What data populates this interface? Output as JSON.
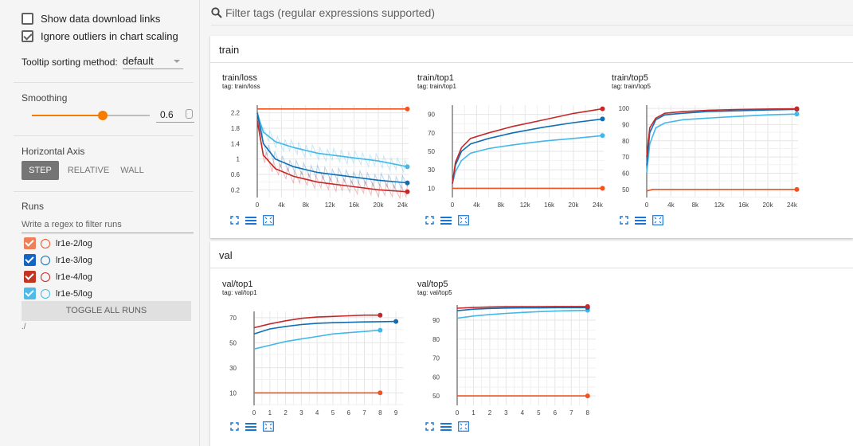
{
  "sidebar": {
    "show_download_label": "Show data download links",
    "ignore_outliers_label": "Ignore outliers in chart scaling",
    "tooltip_label": "Tooltip sorting method:",
    "tooltip_value": "default",
    "smoothing_label": "Smoothing",
    "smoothing_value": "0.6",
    "smoothing_fraction": 0.6,
    "horizontal_axis_label": "Horizontal Axis",
    "axis_options": [
      "STEP",
      "RELATIVE",
      "WALL"
    ],
    "runs_label": "Runs",
    "regex_placeholder": "Write a regex to filter runs",
    "runs": [
      {
        "name": "lr1e-2/log",
        "color": "#f4511e",
        "checkbox_color": "#ef7f57"
      },
      {
        "name": "lr1e-3/log",
        "color": "#0f6eb3",
        "checkbox_color": "#1565c0"
      },
      {
        "name": "lr1e-4/log",
        "color": "#c62828",
        "checkbox_color": "#c43421"
      },
      {
        "name": "lr1e-5/log",
        "color": "#42b8e8",
        "checkbox_color": "#4fb9e8"
      }
    ],
    "toggle_all_label": "TOGGLE ALL RUNS",
    "logdir": "./"
  },
  "filter": {
    "placeholder": "Filter tags (regular expressions supported)"
  },
  "groups": [
    {
      "title": "train"
    },
    {
      "title": "val"
    }
  ],
  "chart_data": [
    {
      "type": "line",
      "title": "train/loss",
      "tag": "tag: train/loss",
      "x_ticks": [
        "0",
        "4k",
        "8k",
        "12k",
        "16k",
        "20k",
        "24k"
      ],
      "y_ticks": [
        "2.2",
        "1.8",
        "1.4",
        "1",
        "0.6",
        "0.2"
      ],
      "xlim": [
        0,
        25000
      ],
      "ylim": [
        0,
        2.4
      ],
      "series": [
        {
          "run": "lr1e-2/log",
          "x": [
            0,
            5000,
            10000,
            15000,
            20000,
            24800
          ],
          "y": [
            2.3,
            2.3,
            2.3,
            2.3,
            2.3,
            2.3
          ]
        },
        {
          "run": "lr1e-5/log",
          "x": [
            0,
            1000,
            3000,
            6000,
            10000,
            15000,
            20000,
            24800
          ],
          "y": [
            2.2,
            1.7,
            1.45,
            1.3,
            1.15,
            1.05,
            0.95,
            0.8
          ]
        },
        {
          "run": "lr1e-3/log",
          "x": [
            0,
            1000,
            3000,
            6000,
            10000,
            15000,
            20000,
            24800
          ],
          "y": [
            2.2,
            1.4,
            1.0,
            0.8,
            0.65,
            0.55,
            0.45,
            0.38
          ]
        },
        {
          "run": "lr1e-4/log",
          "x": [
            0,
            1000,
            3000,
            6000,
            10000,
            15000,
            20000,
            24800
          ],
          "y": [
            2.0,
            1.1,
            0.75,
            0.55,
            0.4,
            0.3,
            0.2,
            0.15
          ]
        }
      ]
    },
    {
      "type": "line",
      "title": "train/top1",
      "tag": "tag: train/top1",
      "x_ticks": [
        "0",
        "4k",
        "8k",
        "12k",
        "16k",
        "20k",
        "24k"
      ],
      "y_ticks": [
        "90",
        "70",
        "50",
        "30",
        "10"
      ],
      "xlim": [
        0,
        25000
      ],
      "ylim": [
        0,
        100
      ],
      "series": [
        {
          "run": "lr1e-2/log",
          "x": [
            0,
            5000,
            10000,
            15000,
            20000,
            24800
          ],
          "y": [
            10,
            10,
            10,
            10,
            10,
            10
          ]
        },
        {
          "run": "lr1e-5/log",
          "x": [
            0,
            500,
            1500,
            3000,
            6000,
            10000,
            15000,
            20000,
            24800
          ],
          "y": [
            15,
            28,
            40,
            48,
            53,
            57,
            61,
            64,
            67
          ]
        },
        {
          "run": "lr1e-3/log",
          "x": [
            0,
            500,
            1500,
            3000,
            6000,
            10000,
            15000,
            20000,
            24800
          ],
          "y": [
            15,
            35,
            50,
            58,
            64,
            70,
            76,
            81,
            85
          ]
        },
        {
          "run": "lr1e-4/log",
          "x": [
            0,
            500,
            1500,
            3000,
            6000,
            10000,
            15000,
            20000,
            24800
          ],
          "y": [
            15,
            38,
            54,
            64,
            70,
            77,
            84,
            91,
            96
          ]
        }
      ]
    },
    {
      "type": "line",
      "title": "train/top5",
      "tag": "tag: train/top5",
      "x_ticks": [
        "0",
        "4k",
        "8k",
        "12k",
        "16k",
        "20k",
        "24k"
      ],
      "y_ticks": [
        "100",
        "90",
        "80",
        "70",
        "60",
        "50"
      ],
      "xlim": [
        0,
        25000
      ],
      "ylim": [
        45,
        102
      ],
      "series": [
        {
          "run": "lr1e-2/log",
          "x": [
            0,
            1000,
            5000,
            10000,
            15000,
            20000,
            24800
          ],
          "y": [
            49,
            50,
            50,
            50,
            50,
            50,
            50
          ]
        },
        {
          "run": "lr1e-5/log",
          "x": [
            0,
            500,
            1500,
            3000,
            6000,
            10000,
            15000,
            20000,
            24800
          ],
          "y": [
            60,
            78,
            88,
            91,
            93,
            94,
            95,
            96,
            96.5
          ]
        },
        {
          "run": "lr1e-3/log",
          "x": [
            0,
            500,
            1500,
            3000,
            6000,
            10000,
            15000,
            20000,
            24800
          ],
          "y": [
            65,
            85,
            93,
            96,
            97,
            98,
            98.5,
            99,
            99.4
          ]
        },
        {
          "run": "lr1e-4/log",
          "x": [
            0,
            500,
            1500,
            3000,
            6000,
            10000,
            15000,
            20000,
            24800
          ],
          "y": [
            70,
            88,
            94,
            97,
            98,
            98.8,
            99.3,
            99.6,
            99.8
          ]
        }
      ]
    },
    {
      "type": "line",
      "title": "val/top1",
      "tag": "tag: val/top1",
      "x_ticks": [
        "0",
        "1",
        "2",
        "3",
        "4",
        "5",
        "6",
        "7",
        "8",
        "9"
      ],
      "y_ticks": [
        "70",
        "50",
        "30",
        "10"
      ],
      "xlim": [
        0,
        9.5
      ],
      "ylim": [
        0,
        75
      ],
      "series": [
        {
          "run": "lr1e-2/log",
          "x": [
            0,
            1,
            2,
            3,
            4,
            5,
            6,
            7,
            8
          ],
          "y": [
            10,
            10,
            10,
            10,
            10,
            10,
            10,
            10,
            10
          ]
        },
        {
          "run": "lr1e-5/log",
          "x": [
            0,
            1,
            2,
            3,
            4,
            5,
            6,
            7,
            8
          ],
          "y": [
            45,
            48,
            51,
            53,
            55,
            57,
            58,
            59,
            60
          ]
        },
        {
          "run": "lr1e-3/log",
          "x": [
            0,
            1,
            2,
            3,
            4,
            5,
            6,
            7,
            8,
            9
          ],
          "y": [
            57,
            61,
            63,
            64.5,
            65.5,
            66,
            66.3,
            66.6,
            66.8,
            67
          ]
        },
        {
          "run": "lr1e-4/log",
          "x": [
            0,
            1,
            2,
            3,
            4,
            5,
            6,
            7,
            8
          ],
          "y": [
            62,
            65,
            67.5,
            69.5,
            70.5,
            71,
            71.5,
            72,
            72
          ]
        }
      ]
    },
    {
      "type": "line",
      "title": "val/top5",
      "tag": "tag: val/top5",
      "x_ticks": [
        "0",
        "1",
        "2",
        "3",
        "4",
        "5",
        "6",
        "7",
        "8"
      ],
      "y_ticks": [
        "90",
        "80",
        "70",
        "60",
        "50"
      ],
      "xlim": [
        0,
        8.5
      ],
      "ylim": [
        45,
        98
      ],
      "series": [
        {
          "run": "lr1e-2/log",
          "x": [
            0,
            2,
            4,
            6,
            8
          ],
          "y": [
            50,
            50,
            50,
            50,
            50
          ]
        },
        {
          "run": "lr1e-5/log",
          "x": [
            0,
            1,
            2,
            3,
            4,
            5,
            6,
            7,
            8
          ],
          "y": [
            91,
            92.2,
            93,
            93.6,
            94.1,
            94.5,
            94.8,
            95,
            95.2
          ]
        },
        {
          "run": "lr1e-3/log",
          "x": [
            0,
            1,
            2,
            3,
            4,
            5,
            6,
            7,
            8
          ],
          "y": [
            95,
            95.8,
            96.2,
            96.4,
            96.5,
            96.5,
            96.6,
            96.6,
            96.6
          ]
        },
        {
          "run": "lr1e-4/log",
          "x": [
            0,
            1,
            2,
            3,
            4,
            5,
            6,
            7,
            8
          ],
          "y": [
            96.3,
            96.7,
            97,
            97.1,
            97.1,
            97.1,
            97.2,
            97.2,
            97.2
          ]
        }
      ]
    }
  ]
}
